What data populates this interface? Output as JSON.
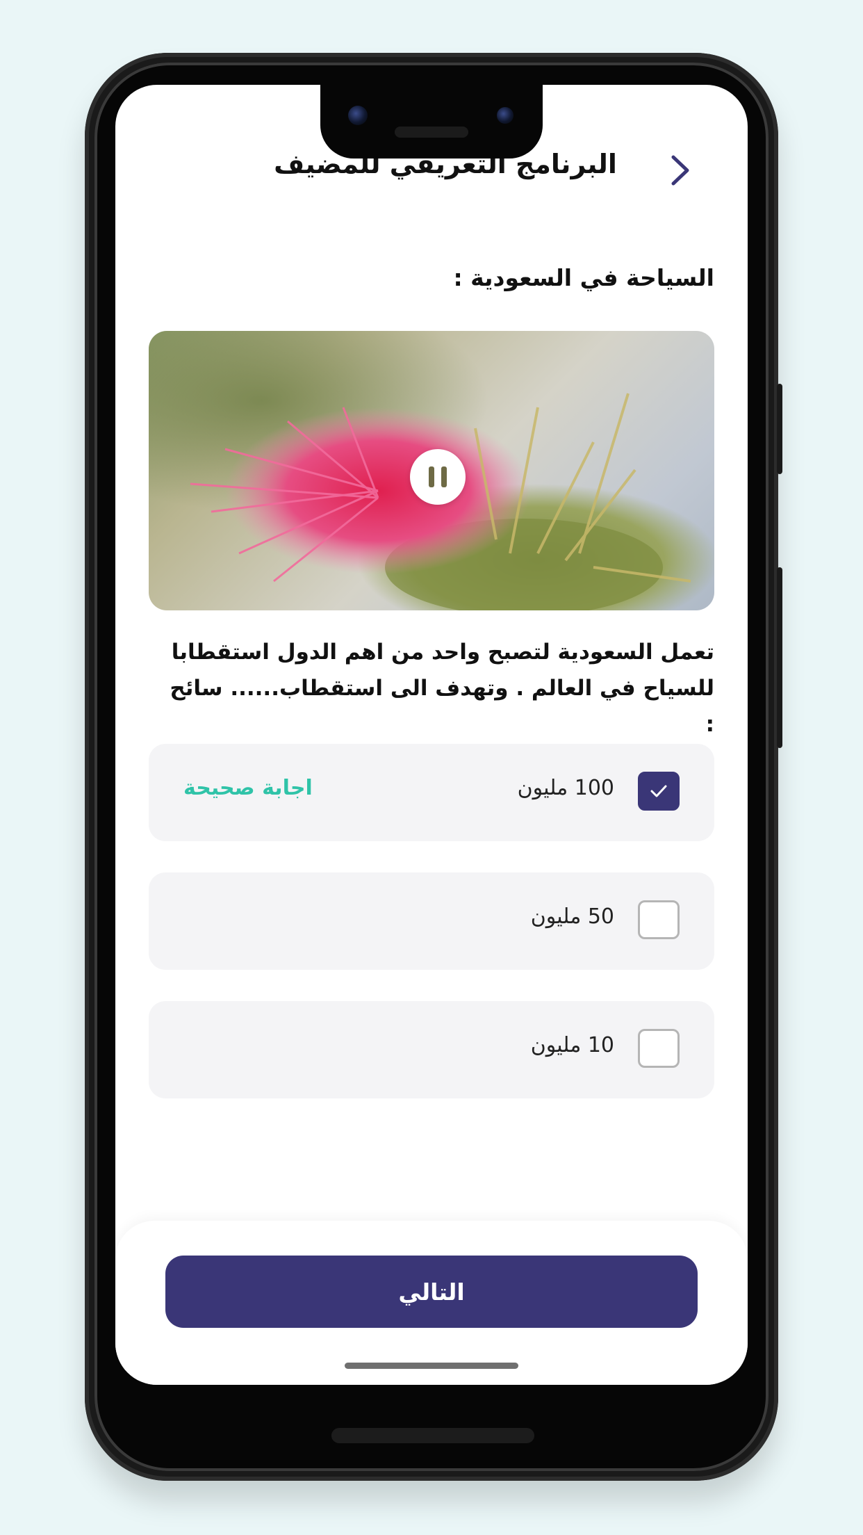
{
  "header": {
    "title": "البرنامج التعريفي للمضيف",
    "back_icon": "chevron-right-icon"
  },
  "section": {
    "title": "السياحة في السعودية :"
  },
  "video": {
    "state": "playing",
    "pause_icon": "pause-icon"
  },
  "question": {
    "text": "تعمل السعودية لتصبح واحد من اهم الدول استقطابا للسياح في العالم . وتهدف الى استقطاب...... سائح :"
  },
  "options": [
    {
      "label": "100 مليون",
      "checked": true,
      "correct_label": "اجابة صحيحة"
    },
    {
      "label": "50 مليون",
      "checked": false
    },
    {
      "label": "10 مليون",
      "checked": false
    }
  ],
  "footer": {
    "next_label": "التالي"
  },
  "colors": {
    "primary": "#3a3677",
    "correct": "#2fc3a8",
    "option_bg": "#f4f4f6"
  }
}
